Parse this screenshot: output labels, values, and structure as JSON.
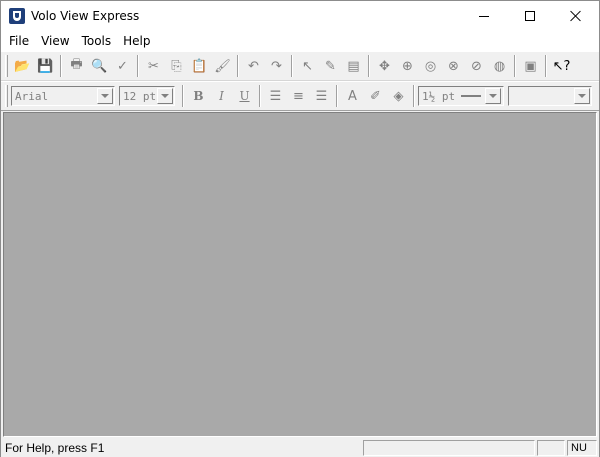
{
  "window": {
    "title": "Volo View Express"
  },
  "menu": [
    "File",
    "View",
    "Tools",
    "Help"
  ],
  "toolbar1": {
    "groups": [
      [
        {
          "icon": "open-folder-icon",
          "glyph": "📂",
          "enabled": true
        },
        {
          "icon": "save-icon",
          "glyph": "💾",
          "enabled": true
        }
      ],
      [
        {
          "icon": "print-icon",
          "glyph": "🖶",
          "enabled": false
        },
        {
          "icon": "print-preview-icon",
          "glyph": "🔍",
          "enabled": false
        },
        {
          "icon": "spell-check-icon",
          "glyph": "✓",
          "enabled": false
        }
      ],
      [
        {
          "icon": "cut-icon",
          "glyph": "✂",
          "enabled": false
        },
        {
          "icon": "copy-icon",
          "glyph": "⎘",
          "enabled": false
        },
        {
          "icon": "paste-icon",
          "glyph": "📋",
          "enabled": false
        },
        {
          "icon": "format-painter-icon",
          "glyph": "🖌",
          "enabled": false
        }
      ],
      [
        {
          "icon": "undo-icon",
          "glyph": "↶",
          "enabled": false
        },
        {
          "icon": "redo-icon",
          "glyph": "↷",
          "enabled": false
        }
      ],
      [
        {
          "icon": "select-arrow-icon",
          "glyph": "↖",
          "enabled": false
        },
        {
          "icon": "markup-pen-icon",
          "glyph": "✎",
          "enabled": false
        },
        {
          "icon": "text-box-icon",
          "glyph": "▤",
          "enabled": false
        }
      ],
      [
        {
          "icon": "realtime-pan-icon",
          "glyph": "✥",
          "enabled": false
        },
        {
          "icon": "zoom-realtime-icon",
          "glyph": "⊕",
          "enabled": false
        },
        {
          "icon": "zoom-window-icon",
          "glyph": "◎",
          "enabled": false
        },
        {
          "icon": "zoom-extents-icon",
          "glyph": "⊗",
          "enabled": false
        },
        {
          "icon": "zoom-previous-icon",
          "glyph": "⊘",
          "enabled": false
        },
        {
          "icon": "orbit-icon",
          "glyph": "◍",
          "enabled": false
        }
      ],
      [
        {
          "icon": "properties-icon",
          "glyph": "▣",
          "enabled": false
        }
      ],
      [
        {
          "icon": "context-help-icon",
          "glyph": "↖?",
          "enabled": true
        }
      ]
    ]
  },
  "toolbar2": {
    "font": "Arial",
    "size": "12 pt",
    "bold": "B",
    "italic": "I",
    "underline": "U",
    "align": [
      {
        "icon": "align-left-icon",
        "glyph": "☰"
      },
      {
        "icon": "align-center-icon",
        "glyph": "≡"
      },
      {
        "icon": "align-right-icon",
        "glyph": "☰"
      }
    ],
    "style_tools": [
      {
        "icon": "font-color-icon",
        "glyph": "A"
      },
      {
        "icon": "highlighter-icon",
        "glyph": "✐"
      },
      {
        "icon": "fill-color-icon",
        "glyph": "◈"
      }
    ],
    "line_width": "1½ pt",
    "layer_value": ""
  },
  "statusbar": {
    "help_text": "For Help, press F1",
    "num_indicator": "NU"
  }
}
